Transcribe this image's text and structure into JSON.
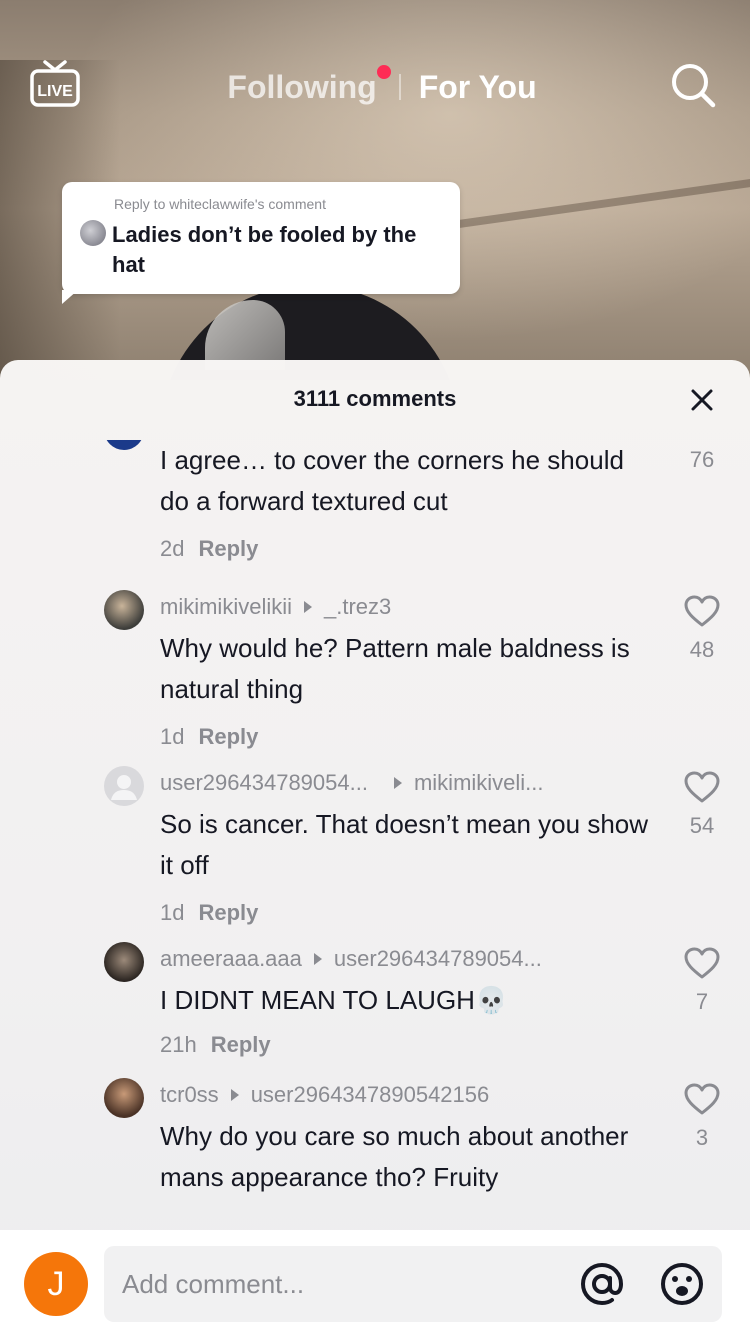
{
  "topnav": {
    "live_label": "LIVE",
    "tab_following": "Following",
    "tab_foryou": "For You"
  },
  "reply_bubble": {
    "reply_to": "Reply to whiteclawwife's comment",
    "text": "Ladies don’t be fooled by the hat"
  },
  "sheet": {
    "count_label": "3111 comments"
  },
  "comments": [
    {
      "username": "",
      "reply_to": "",
      "text": "I agree… to cover the corners he should do a forward textured cut",
      "time": "2d",
      "reply_label": "Reply",
      "likes": "76"
    },
    {
      "username": "mikimikivelikii",
      "reply_to": "_.trez3",
      "text": "Why would he? Pattern male baldness is natural thing",
      "time": "1d",
      "reply_label": "Reply",
      "likes": "48"
    },
    {
      "username": "user296434789054...",
      "reply_to": "mikimikiveli...",
      "text": "So is cancer. That doesn’t mean you show it off",
      "time": "1d",
      "reply_label": "Reply",
      "likes": "54"
    },
    {
      "username": "ameeraaa.aaa",
      "reply_to": "user296434789054...",
      "text": "I DIDNT MEAN TO LAUGH💀",
      "time": "21h",
      "reply_label": "Reply",
      "likes": "7"
    },
    {
      "username": "tcr0ss",
      "reply_to": "user2964347890542156",
      "text": "Why do you care so much about another mans appearance tho? Fruity",
      "time": "",
      "reply_label": "",
      "likes": "3"
    }
  ],
  "input": {
    "avatar_initial": "J",
    "placeholder": "Add comment..."
  },
  "colors": {
    "accent_red": "#fe2c55",
    "avatar_orange": "#f5760a",
    "text_primary": "#161823",
    "text_secondary": "#8a8b91"
  },
  "icons": {
    "live": "tv-live-icon",
    "search": "search-icon",
    "close": "close-icon",
    "like": "heart-outline-icon",
    "mention": "at-icon",
    "emoji": "emoji-icon"
  }
}
